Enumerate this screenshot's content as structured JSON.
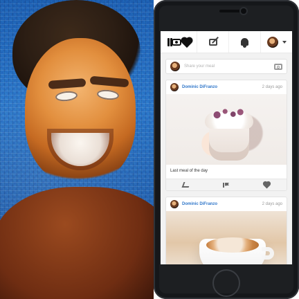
{
  "left_panel": {
    "alt_semantic": "mosaic-portrait"
  },
  "phone": {
    "app": {
      "header": {
        "icons": [
          "fork-knife-icon",
          "camera-icon",
          "heart-icon",
          "edit-icon",
          "bell-icon",
          "user-avatar-icon",
          "chevron-down-icon"
        ]
      },
      "composer": {
        "placeholder": "Share your meal"
      },
      "feed": [
        {
          "user": "Dominic DiFranzo",
          "time": "2 days ago",
          "caption": "Last meal of the day",
          "actions": [
            "reply-icon",
            "flag-icon",
            "heart-icon"
          ]
        },
        {
          "user": "Dominic DiFranzo",
          "time": "2 days ago"
        }
      ]
    }
  }
}
